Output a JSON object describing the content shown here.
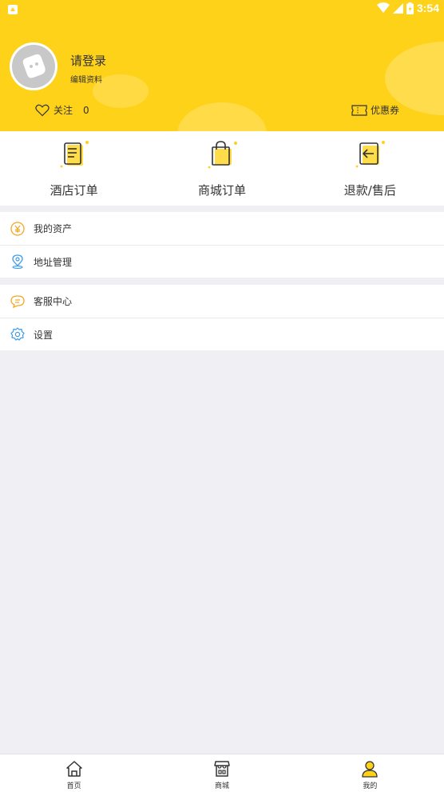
{
  "status_bar": {
    "time": "3:54",
    "icons": [
      "notification-icon",
      "wifi-icon",
      "signal-icon",
      "battery-icon"
    ]
  },
  "colors": {
    "accent": "#ffd21a",
    "background": "#efeff4",
    "text": "#333333",
    "asset_icon": "#f5a623",
    "address_icon": "#3d9be9",
    "service_icon": "#f5a623",
    "settings_icon": "#3d9be9"
  },
  "profile": {
    "login_prompt": "请登录",
    "edit_profile": "编辑资料",
    "follow_label": "关注",
    "follow_count": "0",
    "coupon_label": "优惠券"
  },
  "orders": [
    {
      "label": "酒店订单",
      "icon": "hotel-order-icon"
    },
    {
      "label": "商城订单",
      "icon": "shop-order-icon"
    },
    {
      "label": "退款/售后",
      "icon": "refund-icon"
    }
  ],
  "menu": {
    "group1": [
      {
        "label": "我的资产",
        "icon": "yen-icon"
      },
      {
        "label": "地址管理",
        "icon": "location-pin-icon"
      }
    ],
    "group2": [
      {
        "label": "客服中心",
        "icon": "chat-bubble-icon"
      },
      {
        "label": "设置",
        "icon": "gear-icon"
      }
    ]
  },
  "bottom_nav": [
    {
      "label": "首页",
      "icon": "home-icon",
      "active": false
    },
    {
      "label": "商城",
      "icon": "store-icon",
      "active": false
    },
    {
      "label": "我的",
      "icon": "user-icon",
      "active": true
    }
  ]
}
